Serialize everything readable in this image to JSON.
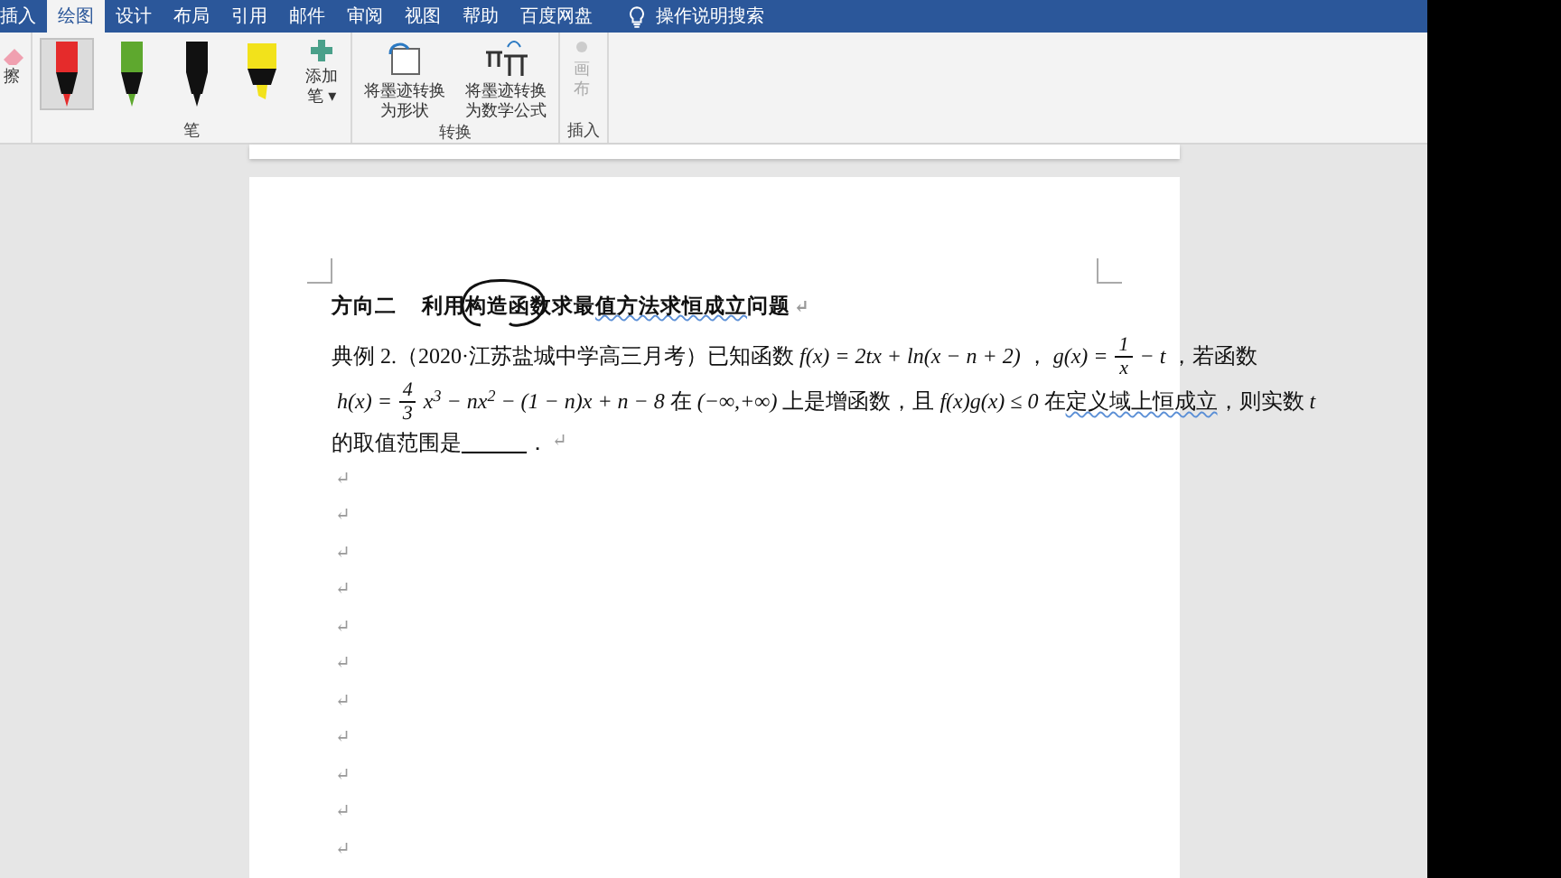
{
  "ribbon": {
    "tabs": [
      {
        "label": "插入",
        "selected": false
      },
      {
        "label": "绘图",
        "selected": true
      },
      {
        "label": "设计",
        "selected": false
      },
      {
        "label": "布局",
        "selected": false
      },
      {
        "label": "引用",
        "selected": false
      },
      {
        "label": "邮件",
        "selected": false
      },
      {
        "label": "审阅",
        "selected": false
      },
      {
        "label": "视图",
        "selected": false
      },
      {
        "label": "帮助",
        "selected": false
      },
      {
        "label": "百度网盘",
        "selected": false
      }
    ],
    "search": {
      "label": "操作说明搜索"
    },
    "eraser": {
      "label": "擦"
    },
    "groups": [
      {
        "label": "笔",
        "items": [
          {
            "kind": "pen",
            "color": "#e52b2b",
            "selected": true
          },
          {
            "kind": "pen",
            "color": "#5ea82e",
            "selected": false
          },
          {
            "kind": "pen",
            "color": "#111111",
            "selected": false
          },
          {
            "kind": "highlighter",
            "color": "#f2e21b",
            "selected": false
          },
          {
            "kind": "add",
            "label": "添加笔 ▾"
          }
        ]
      },
      {
        "label": "转换",
        "items": [
          {
            "kind": "to-shape",
            "label": "将墨迹转换为形状"
          },
          {
            "kind": "to-math",
            "label": "将墨迹转换为数学公式"
          }
        ]
      },
      {
        "label": "插入",
        "items": [
          {
            "kind": "canvas",
            "label": "画布",
            "disabled": true
          }
        ]
      }
    ]
  },
  "document": {
    "lines": [
      {
        "kind": "heading",
        "end_mark": "↵",
        "segments": [
          {
            "kind": "text",
            "text": "方向二"
          },
          {
            "kind": "gap"
          },
          {
            "kind": "text",
            "text": "利用"
          },
          {
            "kind": "text",
            "text": "构造函数",
            "ink_circled": true
          },
          {
            "kind": "text",
            "text": "求最"
          },
          {
            "kind": "text",
            "text": "值方法求恒成立",
            "flagged": true
          },
          {
            "kind": "text",
            "text": "问题"
          }
        ]
      },
      {
        "kind": "body",
        "segments": [
          {
            "kind": "text",
            "text": "典例 2.（2020·江苏盐城中学高三月考）已知函数"
          },
          {
            "kind": "math",
            "text": "f(x) = 2tx + ln(x − n + 2)"
          },
          {
            "kind": "text",
            "text": "，"
          },
          {
            "kind": "math",
            "text": "g(x) = "
          },
          {
            "kind": "fraction",
            "num": "1",
            "den": "x"
          },
          {
            "kind": "math",
            "text": "− t"
          },
          {
            "kind": "text",
            "text": "，若函数"
          }
        ]
      },
      {
        "kind": "body",
        "segments": [
          {
            "kind": "math",
            "text": "h(x) = "
          },
          {
            "kind": "fraction",
            "num": "4",
            "den": "3"
          },
          {
            "kind": "math",
            "text": "x$^{3}$ − nx$^{2}$ − (1 − n)x + n − 8"
          },
          {
            "kind": "text",
            "text": "在"
          },
          {
            "kind": "math",
            "text": "(−∞,+∞)"
          },
          {
            "kind": "text",
            "text": "上是增函数，且"
          },
          {
            "kind": "math",
            "text": "f(x)g(x) ≤ 0"
          },
          {
            "kind": "text",
            "text": "在"
          },
          {
            "kind": "text",
            "text": "定义域上恒成立",
            "flagged": true
          },
          {
            "kind": "text",
            "text": "，则实数"
          },
          {
            "kind": "math",
            "text": "t"
          }
        ]
      },
      {
        "kind": "body",
        "end_mark": "↵",
        "segments": [
          {
            "kind": "text",
            "text": "的取值范围是"
          },
          {
            "kind": "blank",
            "text": "______"
          },
          {
            "kind": "text",
            "text": "．"
          }
        ]
      },
      {
        "kind": "empty",
        "end_mark": "↵"
      },
      {
        "kind": "empty",
        "end_mark": "↵"
      },
      {
        "kind": "empty",
        "end_mark": "↵"
      },
      {
        "kind": "empty",
        "end_mark": "↵"
      },
      {
        "kind": "empty",
        "end_mark": "↵"
      },
      {
        "kind": "empty",
        "end_mark": "↵"
      },
      {
        "kind": "empty",
        "end_mark": "↵"
      },
      {
        "kind": "empty",
        "end_mark": "↵"
      },
      {
        "kind": "empty",
        "end_mark": "↵"
      },
      {
        "kind": "empty",
        "end_mark": "↵"
      },
      {
        "kind": "empty",
        "end_mark": "↵"
      }
    ]
  }
}
